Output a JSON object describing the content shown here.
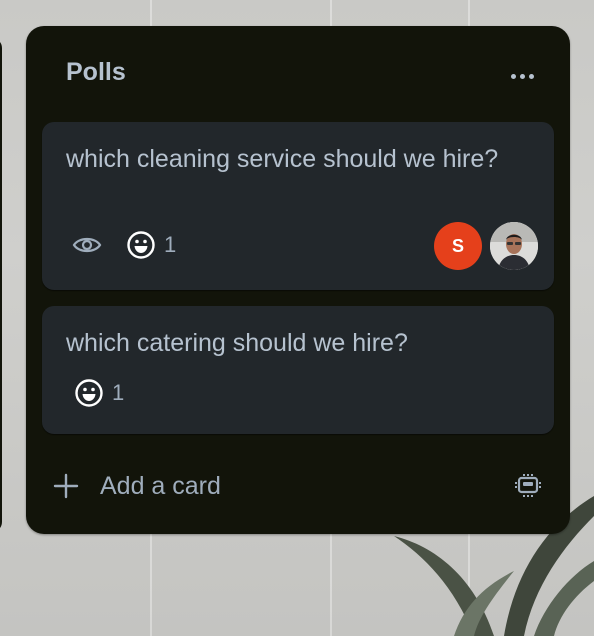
{
  "list": {
    "title": "Polls",
    "more_icon": "more-horizontal-icon",
    "cards": [
      {
        "title": "which cleaning service should we hire?",
        "watch_icon": "eye-icon",
        "reaction_icon": "smiley-icon",
        "reaction_count": "1",
        "members": [
          {
            "initial": "S",
            "color": "#e5401b"
          },
          {
            "type": "photo"
          }
        ]
      },
      {
        "title": "which catering should we hire?",
        "reaction_icon": "smiley-icon",
        "reaction_count": "1"
      }
    ],
    "add_card_label": "Add a card",
    "add_icon": "plus-icon",
    "template_icon": "card-template-icon"
  },
  "colors": {
    "list_bg": "#12140a",
    "card_bg": "#22272b",
    "text": "#b6c2cf",
    "subtle_text": "#9fadbc",
    "avatar_s": "#e5401b"
  }
}
